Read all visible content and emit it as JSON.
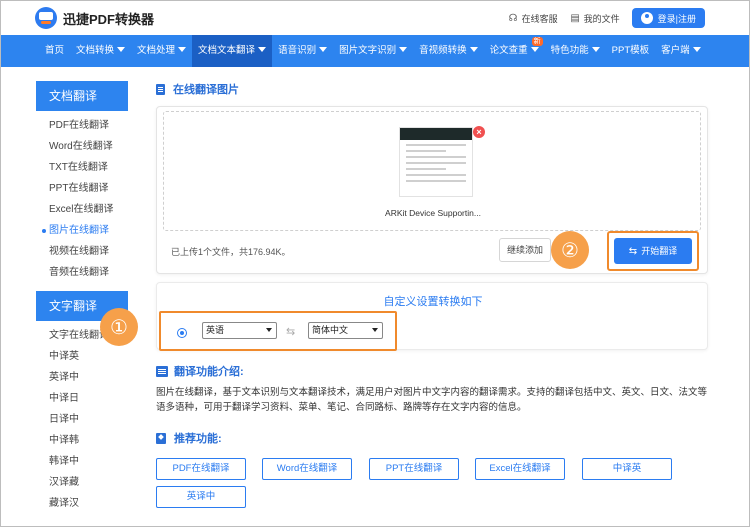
{
  "header": {
    "logo_text": "迅捷PDF转换器",
    "service_label": "在线客服",
    "files_label": "我的文件",
    "login_label": "登录|注册"
  },
  "nav": {
    "items": [
      {
        "label": "首页",
        "dropdown": false
      },
      {
        "label": "文档转换",
        "dropdown": true
      },
      {
        "label": "文档处理",
        "dropdown": true
      },
      {
        "label": "文档文本翻译",
        "dropdown": true,
        "active": true
      },
      {
        "label": "语音识别",
        "dropdown": true
      },
      {
        "label": "图片文字识别",
        "dropdown": true
      },
      {
        "label": "音视频转换",
        "dropdown": true
      },
      {
        "label": "论文查重",
        "dropdown": true,
        "badge": "新"
      },
      {
        "label": "特色功能",
        "dropdown": true
      },
      {
        "label": "PPT模板",
        "dropdown": false
      },
      {
        "label": "客户端",
        "dropdown": true
      }
    ]
  },
  "sidebar": {
    "doc_heading": "文档翻译",
    "doc_items": [
      "PDF在线翻译",
      "Word在线翻译",
      "TXT在线翻译",
      "PPT在线翻译",
      "Excel在线翻译",
      "图片在线翻译",
      "视频在线翻译",
      "音频在线翻译"
    ],
    "text_heading": "文字翻译",
    "text_items": [
      "文字在线翻译",
      "中译英",
      "英译中",
      "中译日",
      "日译中",
      "中译韩",
      "韩译中",
      "汉译藏",
      "藏译汉"
    ]
  },
  "main": {
    "section_title": "在线翻译图片",
    "file_name": "ARKit Device Supportin...",
    "upload_info": "已上传1个文件，共176.94K。",
    "continue_label": "继续添加",
    "start_label": "开始翻译",
    "annotation_1": "①",
    "annotation_2": "②",
    "settings_title": "自定义设置转换如下",
    "source_lang": "英语",
    "target_lang": "简体中文",
    "intro_title": "翻译功能介绍:",
    "intro_text": "图片在线翻译，基于文本识别与文本翻译技术，满足用户对图片中文字内容的翻译需求。支持的翻译包括中文、英文、日文、法文等语多语种，可用于翻译学习资料、菜单、笔记、合同路标、路牌等存在文字内容的信息。",
    "rec_title": "推荐功能:",
    "rec_buttons": [
      "PDF在线翻译",
      "Word在线翻译",
      "PPT在线翻译",
      "Excel在线翻译",
      "中译英",
      "英译中"
    ]
  },
  "colors": {
    "primary": "#2d84ef",
    "nav_active": "#1b5fc4",
    "annotation": "#f08a2c"
  }
}
